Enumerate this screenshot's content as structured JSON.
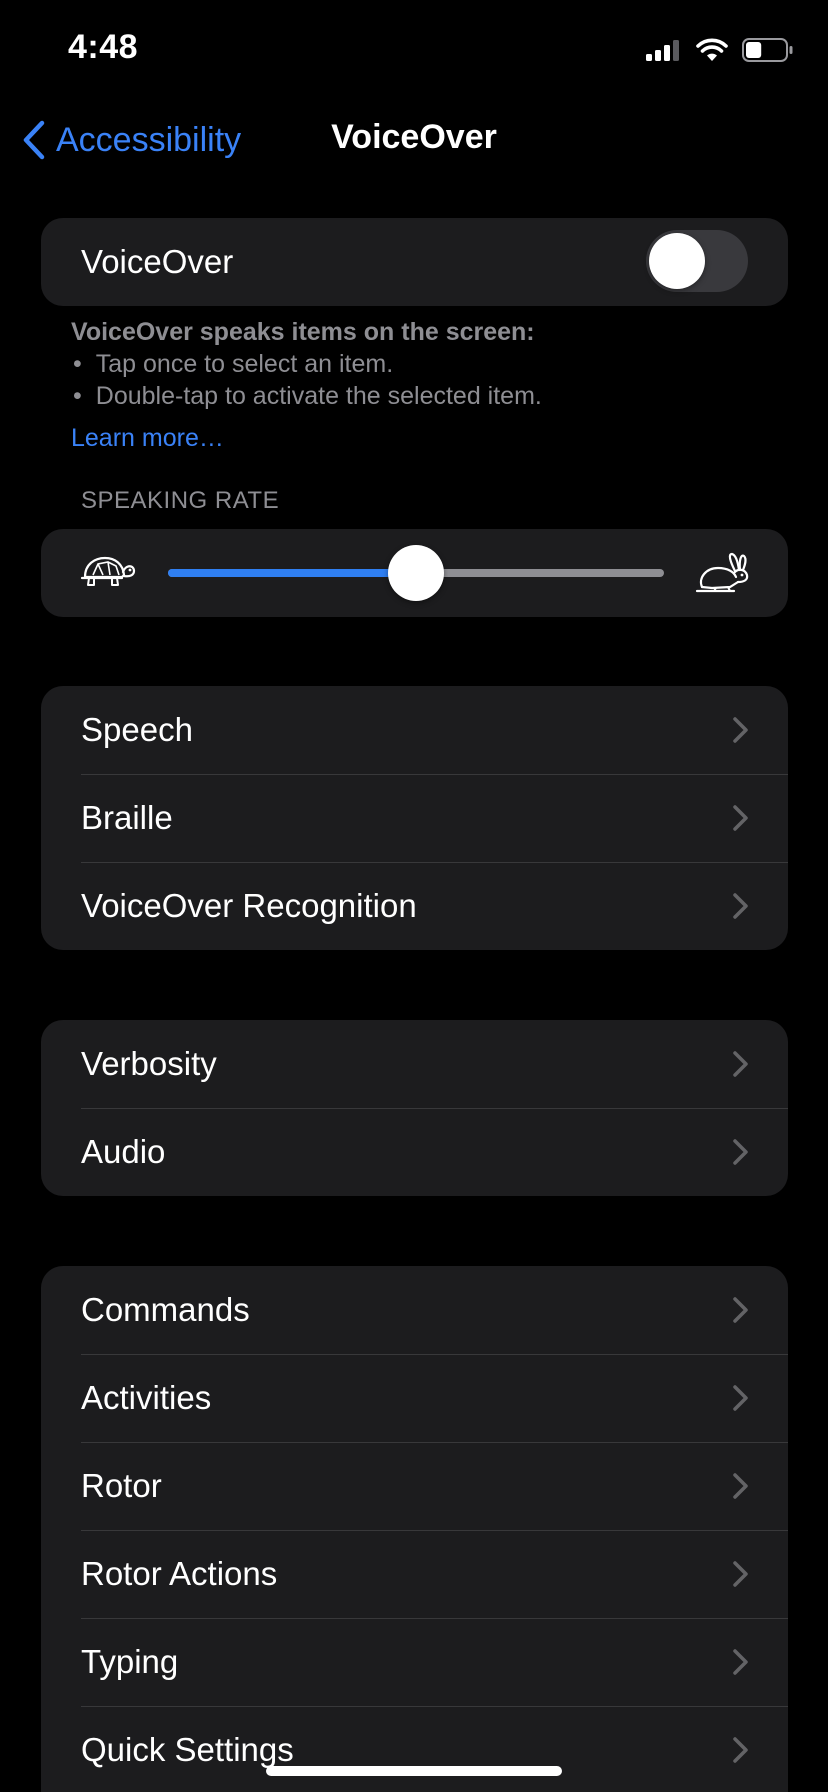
{
  "status_bar": {
    "time": "4:48",
    "icons": [
      "cellular-signal-icon",
      "wifi-icon",
      "battery-icon"
    ],
    "battery_level": 0.4
  },
  "nav": {
    "back_label": "Accessibility",
    "title": "VoiceOver"
  },
  "voiceover": {
    "label": "VoiceOver",
    "toggle_on": false,
    "footer_heading": "VoiceOver speaks items on the screen:",
    "footer_bullets": [
      "Tap once to select an item.",
      "Double-tap to activate the selected item."
    ],
    "bullet": "•",
    "learn_more": "Learn more…"
  },
  "speaking_rate": {
    "header": "SPEAKING RATE",
    "value": 0.5,
    "min_icon": "turtle-icon",
    "max_icon": "rabbit-icon"
  },
  "groups": [
    {
      "items": [
        {
          "label": "Speech"
        },
        {
          "label": "Braille"
        },
        {
          "label": "VoiceOver Recognition"
        }
      ]
    },
    {
      "items": [
        {
          "label": "Verbosity"
        },
        {
          "label": "Audio"
        }
      ]
    },
    {
      "items": [
        {
          "label": "Commands"
        },
        {
          "label": "Activities"
        },
        {
          "label": "Rotor"
        },
        {
          "label": "Rotor Actions"
        },
        {
          "label": "Typing"
        },
        {
          "label": "Quick Settings"
        }
      ]
    }
  ],
  "colors": {
    "accent": "#3a82f7",
    "slider_fill": "#2f7ff2",
    "group_background": "#1c1c1e",
    "secondary_text": "#8e8e93"
  }
}
